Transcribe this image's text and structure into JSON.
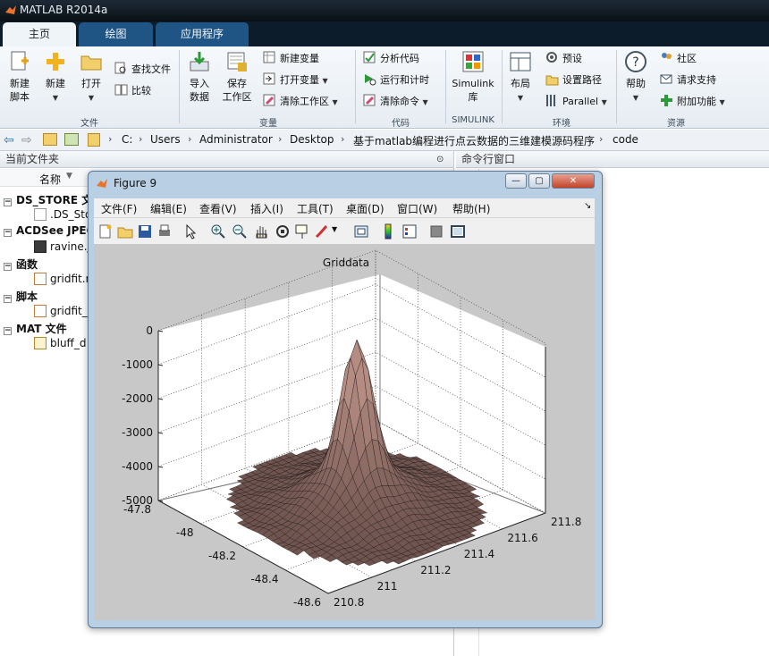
{
  "app": {
    "title": "MATLAB R2014a"
  },
  "tabs": [
    {
      "label": "主页"
    },
    {
      "label": "绘图"
    },
    {
      "label": "应用程序"
    }
  ],
  "ribbon": {
    "file_group": {
      "label": "文件",
      "new_script": "新建\n脚本",
      "new": "新建",
      "open": "打开",
      "find_files": "查找文件",
      "compare": "比较"
    },
    "var_group": {
      "label": "变量",
      "import": "导入\n数据",
      "save_ws": "保存\n工作区",
      "new_var": "新建变量",
      "open_var": "打开变量",
      "clear_ws": "清除工作区"
    },
    "code_group": {
      "label": "代码",
      "analyze": "分析代码",
      "run_time": "运行和计时",
      "clear_cmd": "清除命令"
    },
    "simulink_group": {
      "label": "SIMULINK",
      "simulink_lib": "Simulink\n库"
    },
    "env_group": {
      "label": "环境",
      "layout": "布局",
      "prefs": "预设",
      "set_path": "设置路径",
      "parallel": "Parallel"
    },
    "res_group": {
      "label": "资源",
      "help": "帮助",
      "community": "社区",
      "support": "请求支持",
      "addons": "附加功能"
    }
  },
  "address": {
    "crumbs": [
      "C:",
      "Users",
      "Administrator",
      "Desktop",
      "基于matlab编程进行点云数据的三维建模源码程序",
      "code"
    ]
  },
  "current_folder": {
    "header": "当前文件夹",
    "col_name": "名称",
    "groups": [
      {
        "label": "DS_STORE 文",
        "file": ".DS_Sto"
      },
      {
        "label": "ACDSee JPEG",
        "file": "ravine.j"
      },
      {
        "label": "函数",
        "file": "gridfit.r"
      },
      {
        "label": "脚本",
        "file": "gridfit_"
      },
      {
        "label": "MAT 文件",
        "file": "bluff_d"
      }
    ]
  },
  "command_window": {
    "header": "命令行窗口"
  },
  "figure": {
    "title": "Figure 9",
    "menu": [
      "文件(F)",
      "编辑(E)",
      "查看(V)",
      "插入(I)",
      "工具(T)",
      "桌面(D)",
      "窗口(W)",
      "帮助(H)"
    ]
  },
  "chart_data": {
    "type": "surface",
    "title": "Griddata",
    "zlabel_ticks": [
      "0",
      "-1000",
      "-2000",
      "-3000",
      "-4000",
      "-5000"
    ],
    "ylim_ticks": [
      "-47.8",
      "-48",
      "-48.2",
      "-48.4",
      "-48.6"
    ],
    "xlim_ticks": [
      "210.8",
      "211",
      "211.2",
      "211.4",
      "211.6",
      "211.8"
    ],
    "zlim": [
      -5000,
      0
    ],
    "colormap": "copper/pink",
    "grid": true
  },
  "colors": {
    "accent": "#1f5585",
    "surface": "#8a6f6b"
  }
}
